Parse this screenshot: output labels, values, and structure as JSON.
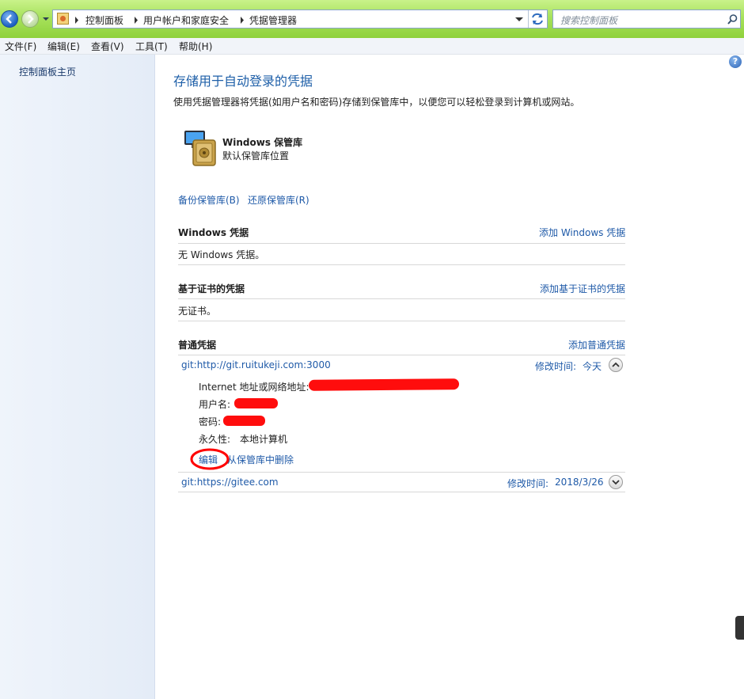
{
  "toolbar": {
    "breadcrumb": [
      "控制面板",
      "用户帐户和家庭安全",
      "凭据管理器"
    ],
    "search_placeholder": "搜索控制面板"
  },
  "menu": [
    "文件(F)",
    "编辑(E)",
    "查看(V)",
    "工具(T)",
    "帮助(H)"
  ],
  "sidebar": {
    "home": "控制面板主页"
  },
  "main": {
    "title": "存储用于自动登录的凭据",
    "description": "使用凭据管理器将凭据(如用户名和密码)存储到保管库中，以便您可以轻松登录到计算机或网站。",
    "vault": {
      "name": "Windows 保管库",
      "subtitle": "默认保管库位置"
    },
    "backup_link": "备份保管库(B)",
    "restore_link": "还原保管库(R)",
    "sections": [
      {
        "title": "Windows 凭据",
        "add_link": "添加 Windows 凭据",
        "empty": "无 Windows 凭据。"
      },
      {
        "title": "基于证书的凭据",
        "add_link": "添加基于证书的凭据",
        "empty": "无证书。"
      },
      {
        "title": "普通凭据",
        "add_link": "添加普通凭据"
      }
    ],
    "credentials": [
      {
        "name": "git:http://git.ruitukeji.com:3000",
        "modified_label": "修改时间:",
        "modified_value": "今天",
        "address_label": "Internet 地址或网络地址:",
        "username_label": "用户名:",
        "password_label": "密码:",
        "persistence_label": "永久性:",
        "persistence_value": "本地计算机",
        "edit_link": "编辑",
        "remove_link": "从保管库中删除"
      },
      {
        "name": "git:https://gitee.com",
        "modified_label": "修改时间:",
        "modified_value": "2018/3/26"
      }
    ]
  },
  "colors": {
    "link": "#1f5aa8",
    "heading": "#1e5fa8",
    "annotation": "#ff0000"
  }
}
